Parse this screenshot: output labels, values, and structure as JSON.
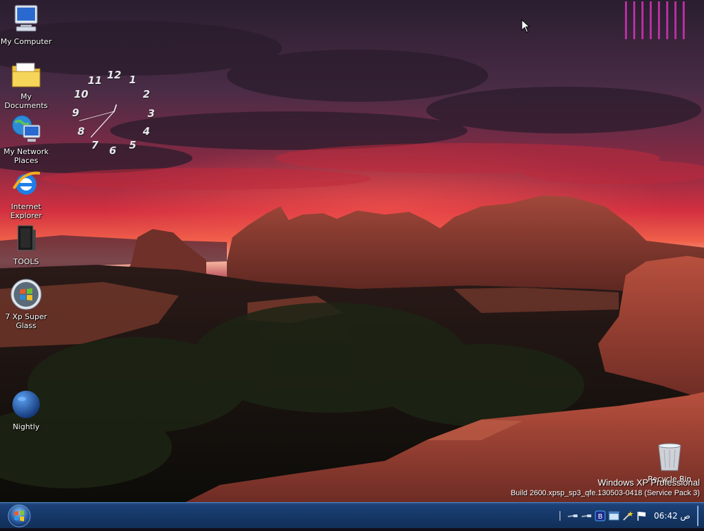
{
  "desktop": {
    "icons": [
      {
        "label": "My Computer",
        "icon": "my-computer-icon"
      },
      {
        "label": "My Documents",
        "icon": "my-documents-icon"
      },
      {
        "label": "My Network Places",
        "icon": "network-places-icon"
      },
      {
        "label": "Internet Explorer",
        "icon": "internet-explorer-icon"
      },
      {
        "label": "TOOLS",
        "icon": "tools-folder-icon"
      },
      {
        "label": "7 Xp Super Glass",
        "icon": "windows-orb-icon"
      },
      {
        "label": "Nightly",
        "icon": "nightly-globe-icon"
      }
    ],
    "recycle_bin": {
      "label": "Recycle Bin",
      "icon": "recycle-bin-icon"
    }
  },
  "clock_widget": {
    "numerals": [
      "12",
      "1",
      "2",
      "3",
      "4",
      "5",
      "6",
      "7",
      "8",
      "9",
      "10",
      "11"
    ],
    "time_shown": "12:37"
  },
  "watermark": {
    "title": "Windows XP Professional",
    "build": "Build 2600.xpsp_sp3_qfe.130503-0418 (Service Pack 3)"
  },
  "taskbar": {
    "start_label": "Start",
    "clock": "06:42 ص",
    "tray_icons": [
      "network-icon",
      "network-icon-2",
      "bluetooth-icon",
      "window-icon",
      "wand-icon",
      "flag-icon"
    ]
  },
  "colors": {
    "taskbar": "#163868",
    "gadget_bars": "#c030a8",
    "sky_red": "#d42a3a"
  }
}
